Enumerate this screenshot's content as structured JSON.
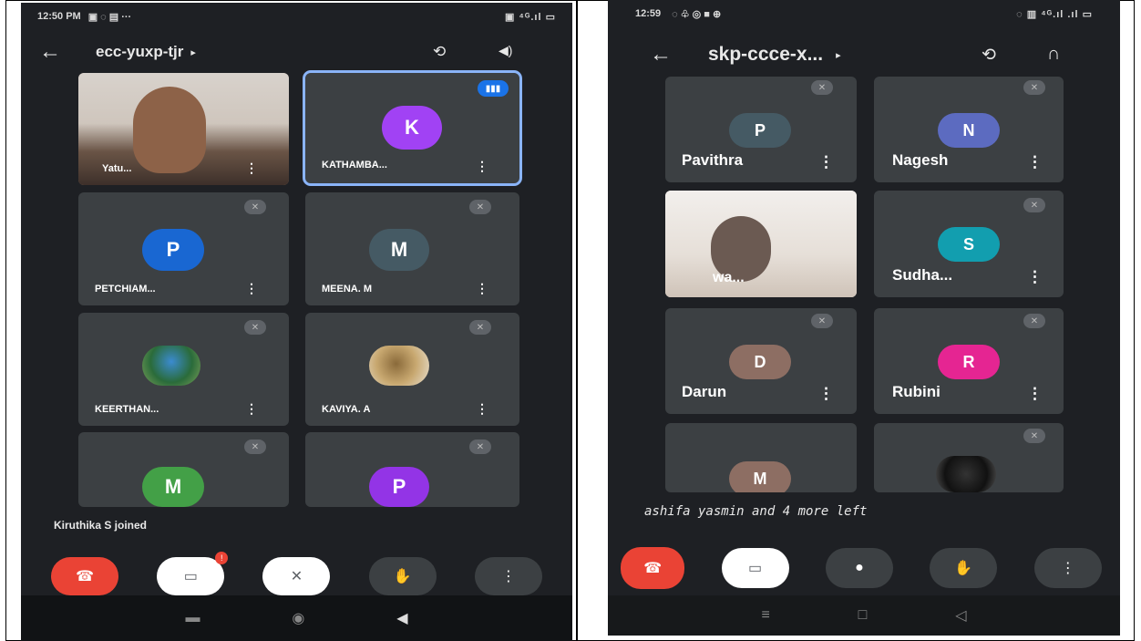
{
  "left": {
    "status": {
      "time": "12:50 PM",
      "icons_left": "▣ ◌ ▤ ···",
      "icons_right": "▣ ⁴ᴳ.ıl ▭"
    },
    "meeting_code": "ecc-yuxp-tjr",
    "participants": [
      {
        "name": "Yatu...",
        "type": "video"
      },
      {
        "name": "KATHAMBA...",
        "initial": "K",
        "color": "#a142f4",
        "speaking": true
      },
      {
        "name": "PETCHIAM...",
        "initial": "P",
        "color": "#1967d2",
        "muted": true
      },
      {
        "name": "MEENA. M",
        "initial": "M",
        "color": "#455a64",
        "muted": true
      },
      {
        "name": "KEERTHAN...",
        "type": "photo",
        "muted": true
      },
      {
        "name": "KAVIYA. A",
        "type": "photo",
        "muted": true
      },
      {
        "name": "",
        "initial": "M",
        "color": "#43a047",
        "muted": true
      },
      {
        "name": "",
        "initial": "P",
        "color": "#9334e6",
        "muted": true
      }
    ],
    "toast": "Kiruthika S joined",
    "camera_badge": "!"
  },
  "right": {
    "status": {
      "time": "12:59",
      "icons_left": "◌ ♧ ◎ ■ ⊕",
      "icons_right": "◌ ▥ ⁴ᴳ.ıl .ıl ▭"
    },
    "meeting_code": "skp-ccce-x...",
    "participants": [
      {
        "name": "Pavithra",
        "initial": "P",
        "color": "#455a64",
        "muted": true
      },
      {
        "name": "Nagesh",
        "initial": "N",
        "color": "#5c6bc0",
        "muted": true
      },
      {
        "name": "wa...",
        "type": "video"
      },
      {
        "name": "Sudha...",
        "initial": "S",
        "color": "#129eaf",
        "muted": true
      },
      {
        "name": "Darun",
        "initial": "D",
        "color": "#8d6e63",
        "muted": true
      },
      {
        "name": "Rubini",
        "initial": "R",
        "color": "#e52592",
        "muted": true
      },
      {
        "name": "",
        "initial": "M",
        "color": "#8d6e63"
      },
      {
        "name": "",
        "type": "photo",
        "muted": true
      }
    ],
    "toast": "ashifa yasmin and 4 more left"
  },
  "icons": {
    "back": "←",
    "caret": "▸",
    "camera_flip": "⟲",
    "speaker": "◀)",
    "headphones": "∩",
    "kebab": "⋮",
    "mic_off": "✕",
    "hangup": "☎",
    "camera_off": "▭",
    "mic": "●",
    "hand": "✋",
    "more": "⋮",
    "nav_home": "▬",
    "nav_circle": "◉",
    "nav_back": "◀",
    "nav_menu": "≡",
    "nav_square": "□",
    "nav_tri": "◁"
  }
}
